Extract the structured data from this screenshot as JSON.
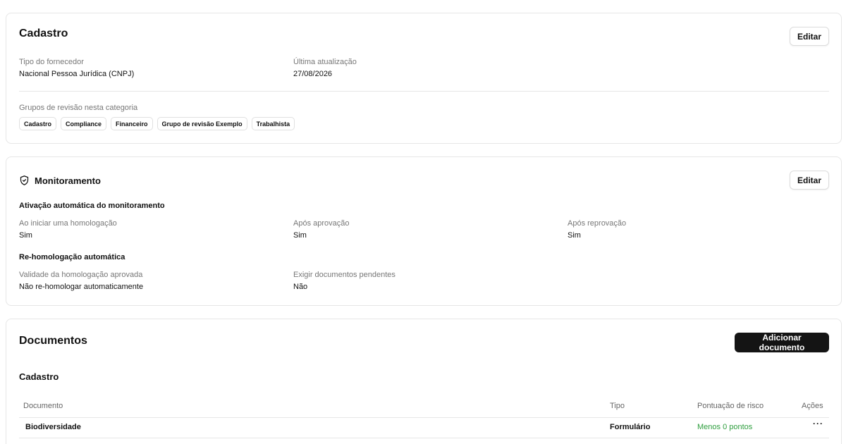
{
  "cadastro_card": {
    "title": "Cadastro",
    "edit_label": "Editar",
    "fields": [
      {
        "label": "Tipo do fornecedor",
        "value": "Nacional Pessoa Jurídica (CNPJ)"
      },
      {
        "label": "Última atualização",
        "value": "27/08/2026"
      }
    ],
    "groups_label": "Grupos de revisão nesta categoria",
    "groups": [
      "Cadastro",
      "Compliance",
      "Financeiro",
      "Grupo de revisão Exemplo",
      "Trabalhista"
    ]
  },
  "monitoring_card": {
    "title": "Monitoramento",
    "icon": "shield-icon",
    "edit_label": "Editar",
    "auto_activation_title": "Ativação automática do monitoramento",
    "auto_activation_fields": [
      {
        "label": "Ao iniciar uma homologação",
        "value": "Sim"
      },
      {
        "label": "Após aprovação",
        "value": "Sim"
      },
      {
        "label": "Após reprovação",
        "value": "Sim"
      }
    ],
    "rehomologation_title": "Re-homologação automática",
    "rehomologation_fields": [
      {
        "label": "Validade da homologação aprovada",
        "value": "Não re-homologar automaticamente"
      },
      {
        "label": "Exigir documentos pendentes",
        "value": "Não"
      }
    ]
  },
  "documents_card": {
    "title": "Documentos",
    "add_label": "Adicionar documento",
    "section_title": "Cadastro",
    "columns": [
      "Documento",
      "Tipo",
      "Pontuação de risco",
      "Ações"
    ],
    "rows": [
      {
        "document": "Biodiversidade",
        "type": "Formulário",
        "risk": "Menos 0 pontos",
        "actions_icon": "more-horizontal-icon"
      }
    ]
  },
  "colors": {
    "risk_text": "#2e9e3e",
    "primary_button": "#141414",
    "border": "#e6e6e6"
  }
}
